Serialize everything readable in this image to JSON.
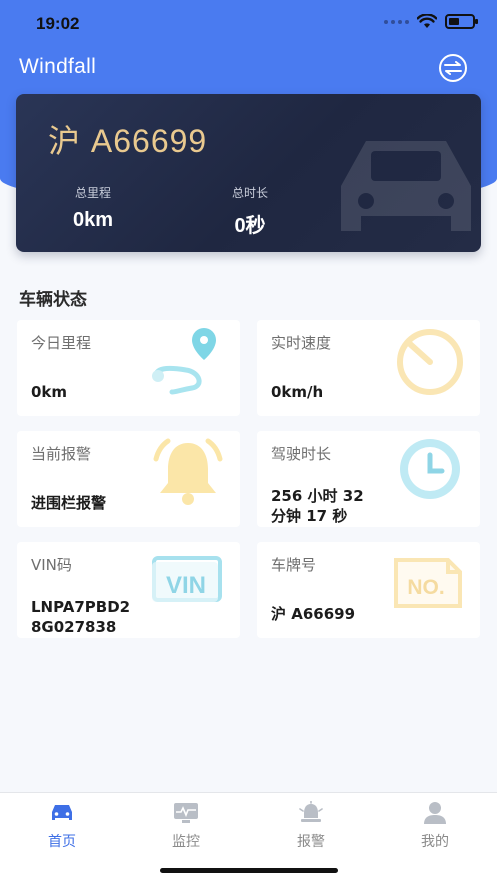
{
  "status_bar": {
    "time": "19:02"
  },
  "header": {
    "title": "Windfall"
  },
  "vehicle_card": {
    "plate": "沪 A66699",
    "total_mileage_label": "总里程",
    "total_mileage_value": "0km",
    "total_duration_label": "总时长",
    "total_duration_value": "0秒"
  },
  "section": {
    "title": "车辆状态"
  },
  "tiles": [
    {
      "label": "今日里程",
      "value": "0km",
      "icon": "route-icon"
    },
    {
      "label": "实时速度",
      "value": "0km/h",
      "icon": "speedometer-icon"
    },
    {
      "label": "当前报警",
      "value": "进围栏报警",
      "icon": "bell-icon"
    },
    {
      "label": "驾驶时长",
      "value": "256 小时 32 分钟 17 秒",
      "value_line1": "256 小时 32",
      "value_line2": "分钟 17 秒",
      "icon": "clock-icon"
    },
    {
      "label": "VIN码",
      "value": "LNPA7PBD28G027838",
      "value_line1": "LNPA7PBD2",
      "value_line2": "8G027838",
      "icon": "vin-icon",
      "icon_text": "VIN"
    },
    {
      "label": "车牌号",
      "value": "沪 A66699",
      "icon": "plate-no-icon",
      "icon_text": "NO."
    }
  ],
  "tabbar": {
    "items": [
      {
        "label": "首页",
        "icon": "car-icon",
        "active": true
      },
      {
        "label": "监控",
        "icon": "monitor-icon",
        "active": false
      },
      {
        "label": "报警",
        "icon": "alarm-icon",
        "active": false
      },
      {
        "label": "我的",
        "icon": "user-icon",
        "active": false
      }
    ]
  },
  "colors": {
    "primary": "#4a7bf0",
    "card_dark": "#232b45",
    "plate_gold": "#e9c98f",
    "active_tab": "#3e6fe6"
  }
}
